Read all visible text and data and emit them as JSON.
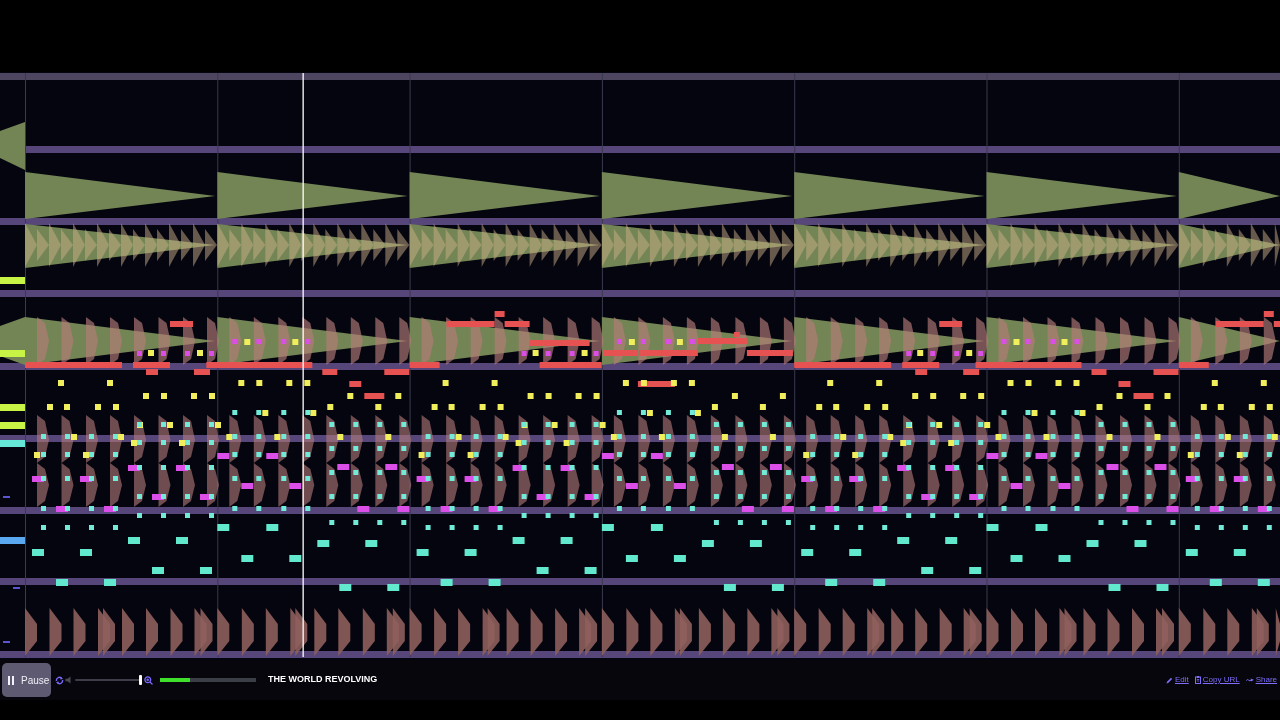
{
  "player": {
    "playing": true,
    "play_button": {
      "label": "Pause"
    },
    "volume": {
      "level": 1.0
    },
    "progress": {
      "level": 0.31
    },
    "song_title": "THE WORLD REVOLVING"
  },
  "links": [
    {
      "kind": "edit",
      "label": "Edit"
    },
    {
      "kind": "copy",
      "label": "Copy URL"
    },
    {
      "kind": "share",
      "label": "Share"
    }
  ]
}
